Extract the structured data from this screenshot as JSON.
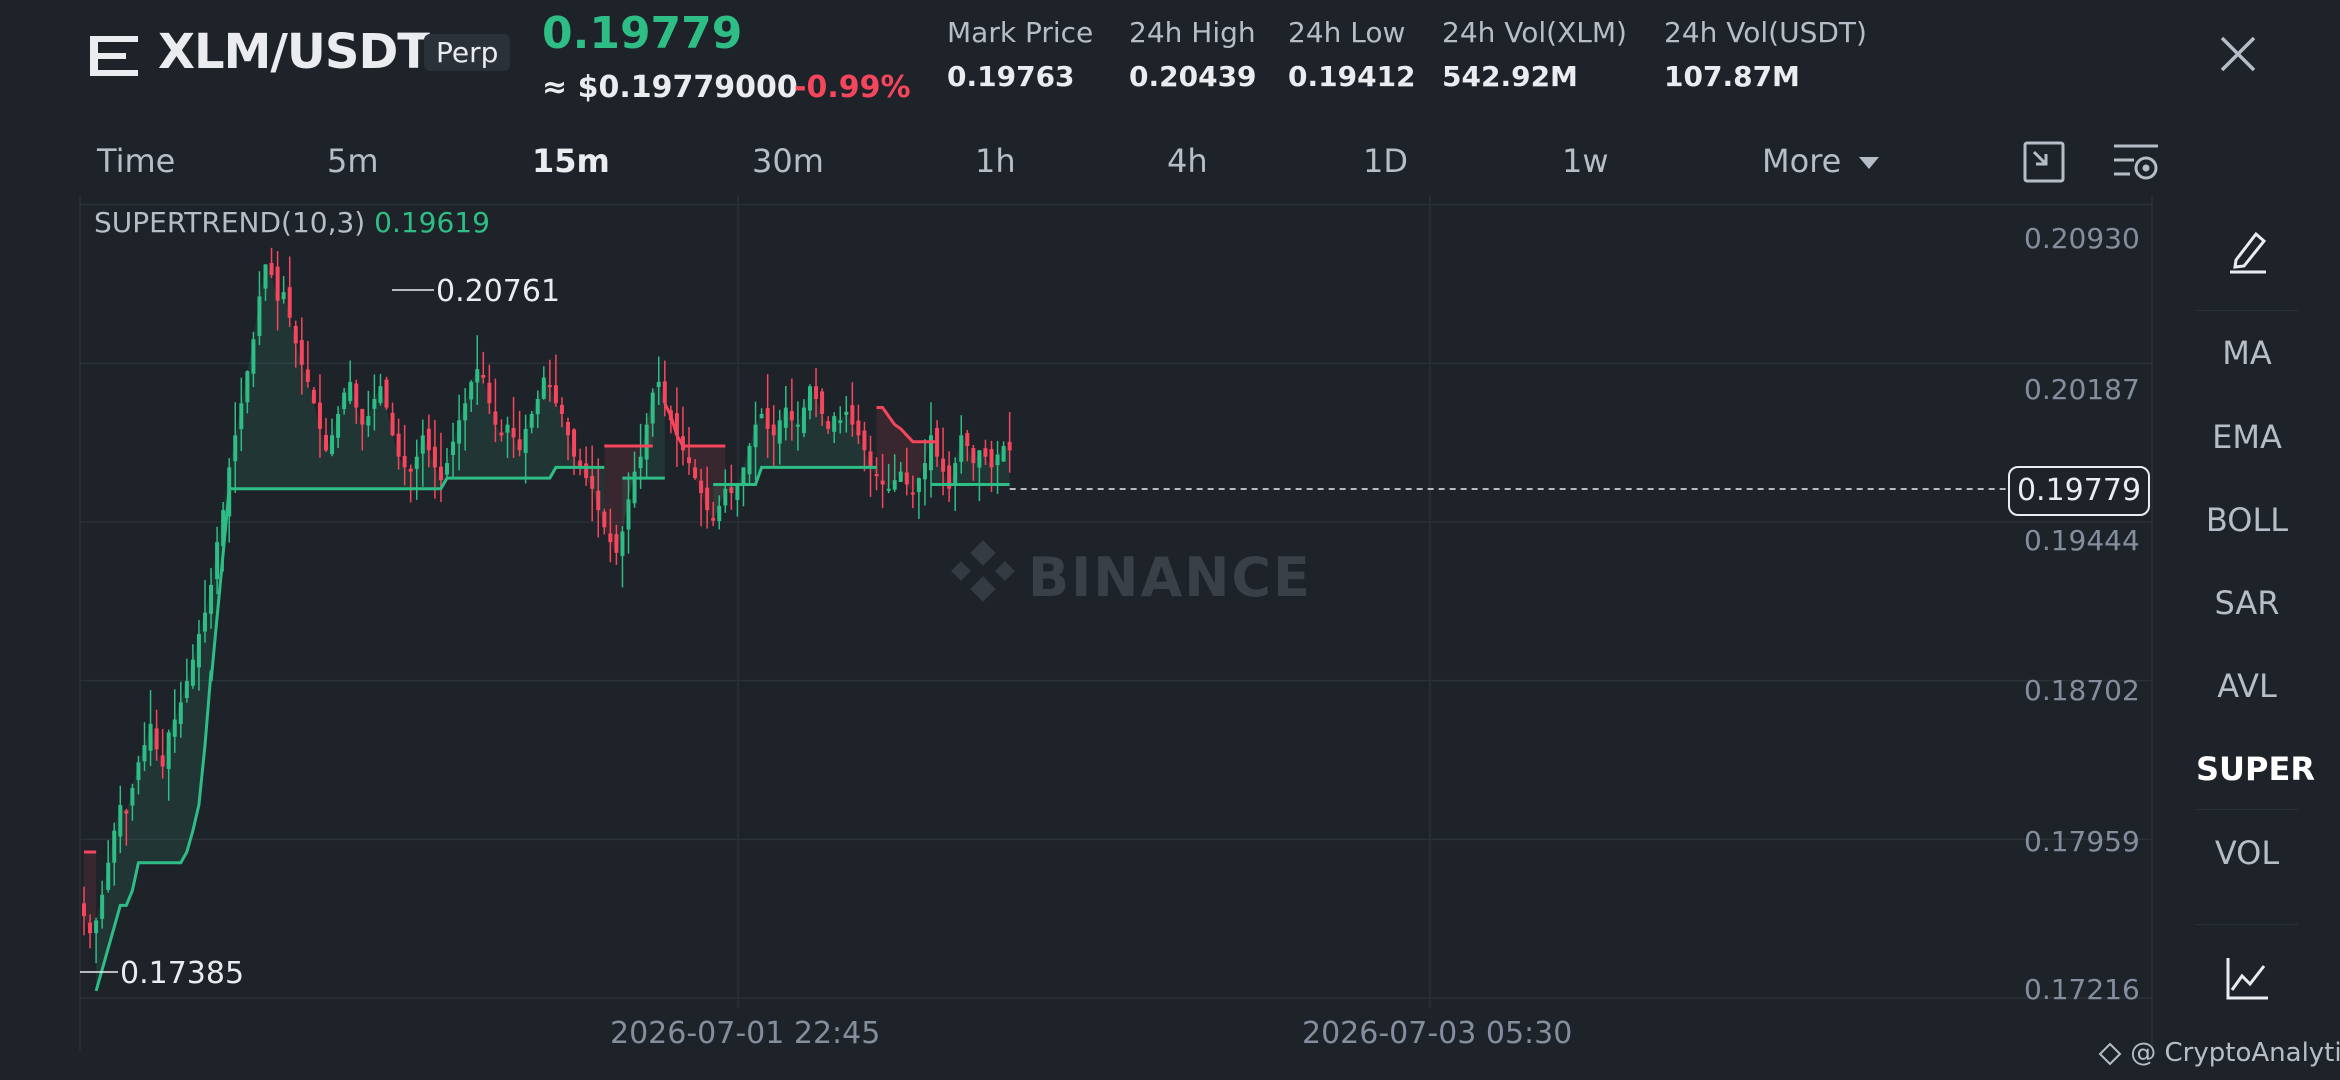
{
  "header": {
    "pair": "XLM/USDT",
    "contract_type": "Perp",
    "last_price": "0.19779",
    "usd_price": "≈ $0.19779000",
    "change": "-0.99%",
    "stats": [
      {
        "label": "Mark Price",
        "value": "0.19763"
      },
      {
        "label": "24h High",
        "value": "0.20439"
      },
      {
        "label": "24h Low",
        "value": "0.19412"
      },
      {
        "label": "24h Vol(XLM)",
        "value": "542.92M"
      },
      {
        "label": "24h Vol(USDT)",
        "value": "107.87M"
      }
    ]
  },
  "intervals": [
    "Time",
    "5m",
    "15m",
    "30m",
    "1h",
    "4h",
    "1D",
    "1w",
    "More"
  ],
  "active_interval": "15m",
  "indicator": {
    "name": "SUPERTREND(10,3)",
    "value": "0.19619"
  },
  "side_panel": {
    "items": [
      "MA",
      "EMA",
      "BOLL",
      "SAR",
      "AVL",
      "SUPER",
      "VOL"
    ],
    "active": "SUPER",
    "icons": [
      "draw-pencil-icon",
      "chart-type-icon"
    ]
  },
  "watermark": "BINANCE",
  "credit": "@ CryptoAnalytica",
  "colors": {
    "up": "#2ebd85",
    "down": "#f6465d",
    "background": "#1e2329",
    "grid": "#2b3139"
  },
  "chart_data": {
    "type": "candlestick",
    "symbol": "XLM/USDT",
    "interval": "15m",
    "y_ticks": [
      "0.20930",
      "0.20187",
      "0.19444",
      "0.18702",
      "0.17959",
      "0.17216"
    ],
    "ylim": [
      0.1717,
      0.2097
    ],
    "x_ticks": [
      "2026-07-01 22:45",
      "2026-07-03 05:30"
    ],
    "current_price": "0.19779",
    "high_label": "0.20761",
    "low_label": "0.17385",
    "grid": true,
    "price_path": [
      0.176,
      0.1752,
      0.1758,
      0.177,
      0.1785,
      0.18,
      0.1812,
      0.1808,
      0.182,
      0.1832,
      0.184,
      0.185,
      0.1838,
      0.183,
      0.1846,
      0.1852,
      0.186,
      0.187,
      0.188,
      0.1892,
      0.1902,
      0.1915,
      0.1935,
      0.195,
      0.197,
      0.1985,
      0.2,
      0.2015,
      0.203,
      0.205,
      0.2065,
      0.206,
      0.2048,
      0.2052,
      0.204,
      0.2028,
      0.2018,
      0.201,
      0.2,
      0.1988,
      0.1978,
      0.1985,
      0.1995,
      0.2005,
      0.201,
      0.1998,
      0.199,
      0.1994,
      0.2002,
      0.2008,
      0.1998,
      0.1985,
      0.1975,
      0.197,
      0.1968,
      0.1975,
      0.1985,
      0.1978,
      0.197,
      0.1964,
      0.1972,
      0.1982,
      0.1992,
      0.2,
      0.201,
      0.2016,
      0.2012,
      0.2,
      0.199,
      0.1985,
      0.199,
      0.1984,
      0.1978,
      0.1988,
      0.1995,
      0.2002,
      0.2012,
      0.2008,
      0.2,
      0.1995,
      0.1985,
      0.1975,
      0.197,
      0.1965,
      0.196,
      0.195,
      0.1942,
      0.1935,
      0.193,
      0.194,
      0.1955,
      0.1968,
      0.1975,
      0.199,
      0.2005,
      0.201,
      0.2,
      0.1992,
      0.1985,
      0.1978,
      0.1972,
      0.1965,
      0.1958,
      0.195,
      0.1945,
      0.1952,
      0.196,
      0.1958,
      0.1962,
      0.197,
      0.198,
      0.199,
      0.1995,
      0.1988,
      0.1985,
      0.1992,
      0.1998,
      0.1992,
      0.199,
      0.1998,
      0.2008,
      0.2002,
      0.1995,
      0.1988,
      0.1994,
      0.1992,
      0.1996,
      0.199,
      0.1985,
      0.1978,
      0.197,
      0.1966,
      0.1962,
      0.196,
      0.1964,
      0.1968,
      0.1962,
      0.1958,
      0.1965,
      0.1972,
      0.1985,
      0.1975,
      0.1968,
      0.196,
      0.1972,
      0.1985,
      0.198,
      0.1972,
      0.1978,
      0.1975,
      0.197,
      0.1976,
      0.198,
      0.1978
    ],
    "supertrend_segments": [
      {
        "trend": "down",
        "from": 0,
        "to": 2,
        "level": 0.179
      },
      {
        "trend": "up",
        "from": 2,
        "to": 21,
        "path": [
          0.1725,
          0.1735,
          0.1745,
          0.1755,
          0.1765,
          0.1765,
          0.1772,
          0.1785,
          0.1785,
          0.1785,
          0.1785,
          0.1785,
          0.1785,
          0.1785,
          0.1785,
          0.179,
          0.18,
          0.1812,
          0.184,
          0.1875
        ]
      },
      {
        "trend": "up",
        "from": 21,
        "to": 86,
        "path_start": 0.187,
        "level": 0.196,
        "steps": [
          [
            60,
            0.1965
          ],
          [
            75,
            0.1965
          ],
          [
            78,
            0.197
          ]
        ]
      },
      {
        "trend": "down",
        "from": 86,
        "to": 94,
        "level": 0.198
      },
      {
        "trend": "up",
        "from": 89,
        "to": 96,
        "level": 0.1965
      },
      {
        "trend": "down",
        "from": 96,
        "to": 106,
        "path": [
          0.2,
          0.1994,
          0.1985,
          0.198,
          0.198,
          0.198,
          0.198,
          0.198,
          0.198,
          0.198
        ]
      },
      {
        "trend": "up",
        "from": 104,
        "to": 131,
        "level": 0.1962,
        "steps": [
          [
            112,
            0.197
          ]
        ]
      },
      {
        "trend": "down",
        "from": 131,
        "to": 141,
        "path": [
          0.1998,
          0.1998,
          0.1994,
          0.199,
          0.1988,
          0.1985,
          0.1982,
          0.1982,
          0.1982,
          0.1982
        ]
      },
      {
        "trend": "up",
        "from": 140,
        "to": 153,
        "level": 0.1962
      }
    ]
  }
}
